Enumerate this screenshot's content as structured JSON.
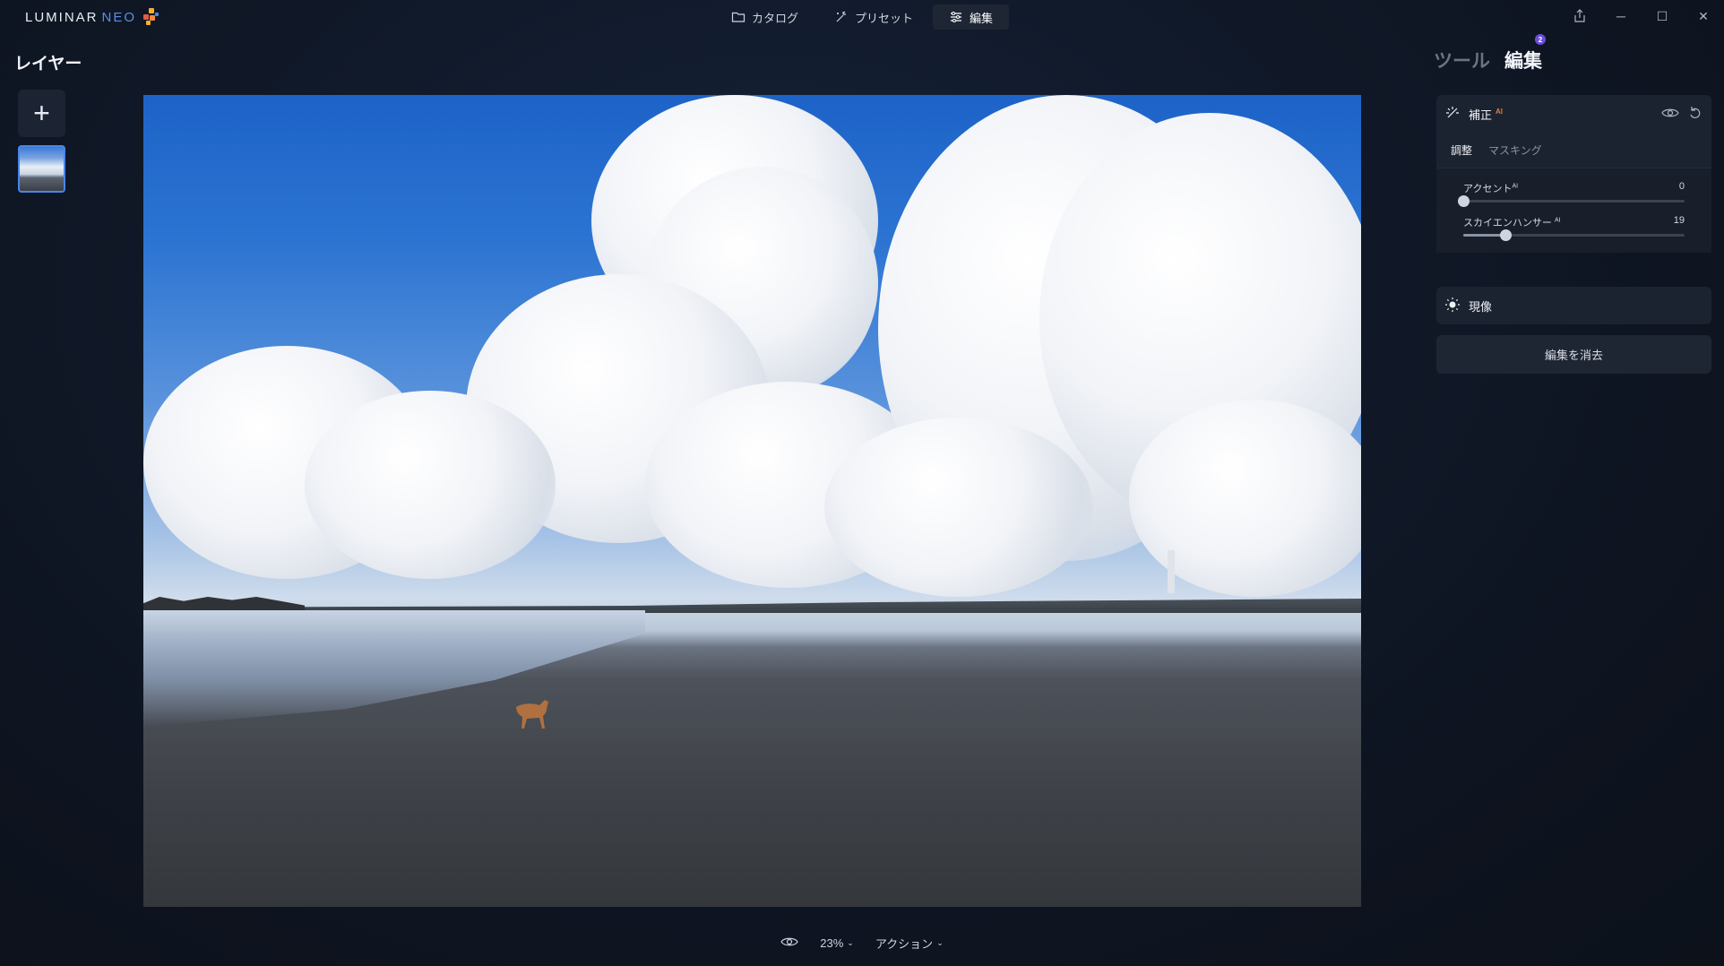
{
  "app": {
    "logo_main": "LUMINAR",
    "logo_sub": "NEO"
  },
  "nav": {
    "items": [
      {
        "label": "カタログ",
        "icon": "folder-icon"
      },
      {
        "label": "プリセット",
        "icon": "sparkle-icon"
      },
      {
        "label": "編集",
        "icon": "sliders-icon",
        "active": true
      }
    ]
  },
  "window_controls": {
    "share": "share-icon",
    "minimize": "minimize-icon",
    "maximize": "maximize-icon",
    "close": "close-icon"
  },
  "layers": {
    "title": "レイヤー",
    "add_label": "+"
  },
  "bottom": {
    "zoom": "23%",
    "actions": "アクション"
  },
  "right_panel": {
    "tabs": [
      {
        "label": "ツール"
      },
      {
        "label": "編集",
        "active": true,
        "badge": "2"
      }
    ],
    "enhance": {
      "title": "補正",
      "ai": "AI",
      "subtabs": [
        "調整",
        "マスキング"
      ],
      "sliders": [
        {
          "label": "アクセント",
          "ai": "AI",
          "value": "0",
          "level": 0.0
        },
        {
          "label": "スカイエンハンサー",
          "ai": "AI",
          "value": "19",
          "level": 0.19
        }
      ]
    },
    "develop": {
      "title": "現像"
    },
    "clear_button": "編集を消去"
  },
  "colors": {
    "accent": "#4a86e8",
    "badge": "#6a4fd8",
    "ai_tag": "#e07a3a"
  }
}
